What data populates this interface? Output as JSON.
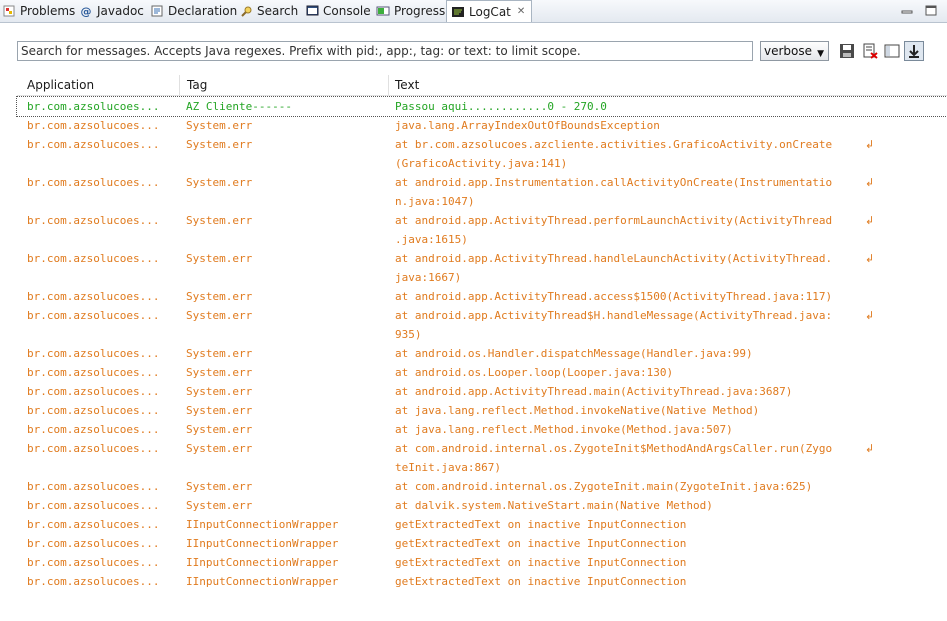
{
  "tabs": [
    {
      "label": "Problems",
      "icon": "problems-icon"
    },
    {
      "label": "Javadoc",
      "icon": "at-icon"
    },
    {
      "label": "Declaration",
      "icon": "declaration-icon"
    },
    {
      "label": "Search",
      "icon": "search-icon"
    },
    {
      "label": "Console",
      "icon": "console-icon"
    },
    {
      "label": "Progress",
      "icon": "progress-icon"
    },
    {
      "label": "LogCat",
      "icon": "logcat-icon",
      "close": "✕"
    }
  ],
  "search": {
    "placeholder": "Search for messages. Accepts Java regexes. Prefix with pid:, app:, tag: or text: to limit scope."
  },
  "level": {
    "value": "verbose"
  },
  "columns": {
    "application": "Application",
    "tag": "Tag",
    "text": "Text"
  },
  "colors": {
    "verbose": "#e07b1f",
    "info": "#24a524"
  },
  "rows": [
    {
      "app": "br.com.azsolucoes...",
      "tag": "AZ Cliente------",
      "text": "Passou aqui............0 - 270.0",
      "selected": true
    },
    {
      "app": "br.com.azsolucoes...",
      "tag": "System.err",
      "text": "java.lang.ArrayIndexOutOfBoundsException"
    },
    {
      "app": "br.com.azsolucoes...",
      "tag": "System.err",
      "text": "at br.com.azsolucoes.azcliente.activities.GraficoActivity.onCreate\n(GraficoActivity.java:141)",
      "wrapped": true
    },
    {
      "app": "br.com.azsolucoes...",
      "tag": "System.err",
      "text": "at android.app.Instrumentation.callActivityOnCreate(Instrumentatio\nn.java:1047)",
      "wrapped": true
    },
    {
      "app": "br.com.azsolucoes...",
      "tag": "System.err",
      "text": "at android.app.ActivityThread.performLaunchActivity(ActivityThread\n.java:1615)",
      "wrapped": true
    },
    {
      "app": "br.com.azsolucoes...",
      "tag": "System.err",
      "text": "at android.app.ActivityThread.handleLaunchActivity(ActivityThread.\njava:1667)",
      "wrapped": true
    },
    {
      "app": "br.com.azsolucoes...",
      "tag": "System.err",
      "text": "at android.app.ActivityThread.access$1500(ActivityThread.java:117)"
    },
    {
      "app": "br.com.azsolucoes...",
      "tag": "System.err",
      "text": "at android.app.ActivityThread$H.handleMessage(ActivityThread.java:\n935)",
      "wrapped": true
    },
    {
      "app": "br.com.azsolucoes...",
      "tag": "System.err",
      "text": "at android.os.Handler.dispatchMessage(Handler.java:99)"
    },
    {
      "app": "br.com.azsolucoes...",
      "tag": "System.err",
      "text": "at android.os.Looper.loop(Looper.java:130)"
    },
    {
      "app": "br.com.azsolucoes...",
      "tag": "System.err",
      "text": "at android.app.ActivityThread.main(ActivityThread.java:3687)"
    },
    {
      "app": "br.com.azsolucoes...",
      "tag": "System.err",
      "text": "at java.lang.reflect.Method.invokeNative(Native Method)"
    },
    {
      "app": "br.com.azsolucoes...",
      "tag": "System.err",
      "text": "at java.lang.reflect.Method.invoke(Method.java:507)"
    },
    {
      "app": "br.com.azsolucoes...",
      "tag": "System.err",
      "text": "at com.android.internal.os.ZygoteInit$MethodAndArgsCaller.run(Zygo\nteInit.java:867)",
      "wrapped": true
    },
    {
      "app": "br.com.azsolucoes...",
      "tag": "System.err",
      "text": "at com.android.internal.os.ZygoteInit.main(ZygoteInit.java:625)"
    },
    {
      "app": "br.com.azsolucoes...",
      "tag": "System.err",
      "text": "at dalvik.system.NativeStart.main(Native Method)"
    },
    {
      "app": "br.com.azsolucoes...",
      "tag": "IInputConnectionWrapper",
      "text": "getExtractedText on inactive InputConnection"
    },
    {
      "app": "br.com.azsolucoes...",
      "tag": "IInputConnectionWrapper",
      "text": "getExtractedText on inactive InputConnection"
    },
    {
      "app": "br.com.azsolucoes...",
      "tag": "IInputConnectionWrapper",
      "text": "getExtractedText on inactive InputConnection"
    },
    {
      "app": "br.com.azsolucoes...",
      "tag": "IInputConnectionWrapper",
      "text": "getExtractedText on inactive InputConnection"
    }
  ]
}
